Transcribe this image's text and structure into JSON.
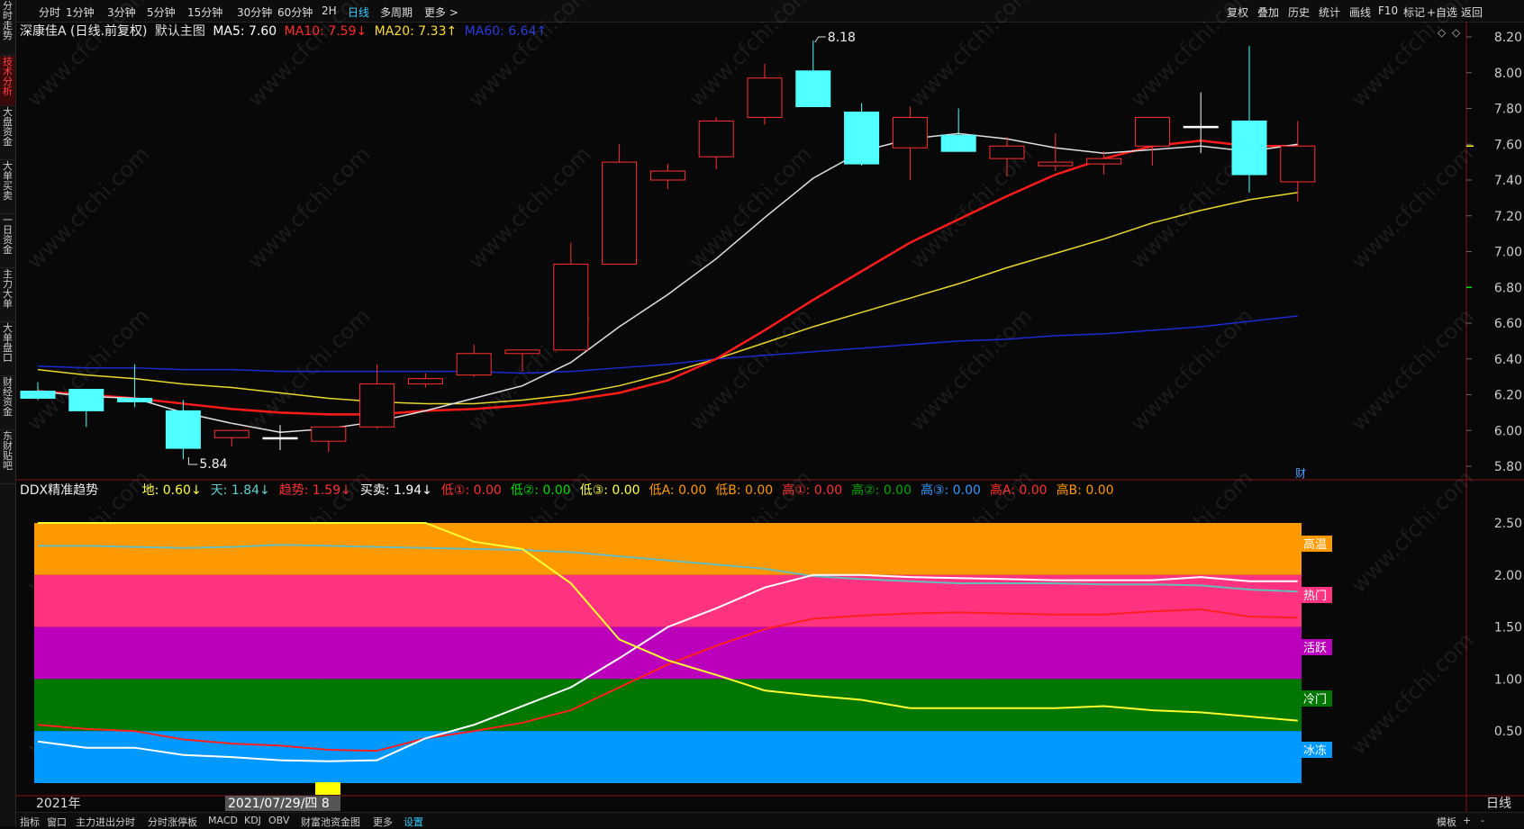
{
  "side_tabs": [
    "分时走势",
    "技术分析",
    "大盘资金",
    "大单买卖",
    "一日资金",
    "主力大单",
    "大单盘口",
    "财经资金",
    "东财贴吧"
  ],
  "side_active": 1,
  "top_menu": [
    "分时",
    "1分钟",
    "3分钟",
    "5分钟",
    "15分钟",
    "30分钟",
    "60分钟",
    "2H",
    "日线",
    "多周期",
    "更多 >"
  ],
  "top_active": 8,
  "top_right": [
    "复权",
    "叠加",
    "历史",
    "统计",
    "画线",
    "F10",
    "标记",
    "+自选",
    "返回"
  ],
  "chart1": {
    "name": "深康佳A (日线.前复权)",
    "main_label": "默认主图",
    "ma5": "MA5: 7.60",
    "ma10": "MA10: 7.59↓",
    "ma20": "MA20: 7.33↑",
    "ma60": "MA60: 6.64↑",
    "hi_label": "8.18",
    "lo_label": "5.84",
    "fin_tag": "财"
  },
  "chart2": {
    "name": "DDX精准趋势",
    "items": [
      {
        "t": "地: 0.60↓",
        "c": "#ffff40"
      },
      {
        "t": "天: 1.84↓",
        "c": "#66cccc"
      },
      {
        "t": "趋势: 1.59↓",
        "c": "#ff3030"
      },
      {
        "t": "买卖: 1.94↓",
        "c": "#ffffff"
      },
      {
        "t": "低①: 0.00",
        "c": "#ff3030"
      },
      {
        "t": "低②: 0.00",
        "c": "#00dd00"
      },
      {
        "t": "低③: 0.00",
        "c": "#ffff40"
      },
      {
        "t": "低A: 0.00",
        "c": "#ff9900"
      },
      {
        "t": "低B: 0.00",
        "c": "#ff9900"
      },
      {
        "t": "高①: 0.00",
        "c": "#ff3030"
      },
      {
        "t": "高②: 0.00",
        "c": "#00aa00"
      },
      {
        "t": "高③: 0.00",
        "c": "#3399ff"
      },
      {
        "t": "高A: 0.00",
        "c": "#ff3030"
      },
      {
        "t": "高B: 0.00",
        "c": "#ff9900"
      }
    ],
    "zones": [
      "高温",
      "热门",
      "活跃",
      "冷门",
      "冰冻"
    ]
  },
  "y_axis_top": [
    "8.20",
    "8.00",
    "7.80",
    "7.60",
    "7.40",
    "7.20",
    "7.00",
    "6.80",
    "6.60",
    "6.40",
    "6.20",
    "6.00",
    "5.80"
  ],
  "y_axis_bottom": [
    "2.50",
    "2.00",
    "1.50",
    "1.00",
    "0.50"
  ],
  "date_left": "2021年",
  "date_cursor": "2021/07/29/四 8",
  "bottom_tabs": [
    "指标",
    "窗口",
    "主力进出分时",
    "分时涨停板",
    "MACD",
    "KDJ",
    "OBV",
    "财富池资金图",
    "更多",
    "设置"
  ],
  "bottom_right": [
    "模板",
    "+",
    "-"
  ],
  "period_label": "日线",
  "watermark": "www.cfchi.com",
  "chart_data": {
    "type": "candlestick",
    "candles": [
      {
        "o": 6.22,
        "c": 6.18,
        "h": 6.27,
        "l": 6.17
      },
      {
        "o": 6.23,
        "c": 6.11,
        "h": 6.23,
        "l": 6.02
      },
      {
        "o": 6.18,
        "c": 6.16,
        "h": 6.37,
        "l": 6.13
      },
      {
        "o": 6.11,
        "c": 5.9,
        "h": 6.17,
        "l": 5.84
      },
      {
        "o": 5.96,
        "c": 6.0,
        "h": 6.0,
        "l": 5.91
      },
      {
        "o": 5.96,
        "c": 5.96,
        "h": 6.03,
        "l": 5.89
      },
      {
        "o": 5.94,
        "c": 6.02,
        "h": 6.02,
        "l": 5.88
      },
      {
        "o": 6.02,
        "c": 6.26,
        "h": 6.37,
        "l": 6.01
      },
      {
        "o": 6.26,
        "c": 6.29,
        "h": 6.32,
        "l": 6.24
      },
      {
        "o": 6.31,
        "c": 6.43,
        "h": 6.48,
        "l": 6.3
      },
      {
        "o": 6.43,
        "c": 6.45,
        "h": 6.45,
        "l": 6.33
      },
      {
        "o": 6.45,
        "c": 6.93,
        "h": 7.05,
        "l": 6.45
      },
      {
        "o": 6.93,
        "c": 7.5,
        "h": 7.6,
        "l": 6.93
      },
      {
        "o": 7.4,
        "c": 7.45,
        "h": 7.49,
        "l": 7.35
      },
      {
        "o": 7.53,
        "c": 7.73,
        "h": 7.75,
        "l": 7.46
      },
      {
        "o": 7.75,
        "c": 7.97,
        "h": 8.05,
        "l": 7.71
      },
      {
        "o": 8.01,
        "c": 7.81,
        "h": 8.18,
        "l": 7.81
      },
      {
        "o": 7.78,
        "c": 7.49,
        "h": 7.83,
        "l": 7.48
      },
      {
        "o": 7.58,
        "c": 7.75,
        "h": 7.81,
        "l": 7.4
      },
      {
        "o": 7.65,
        "c": 7.56,
        "h": 7.8,
        "l": 7.56
      },
      {
        "o": 7.52,
        "c": 7.59,
        "h": 7.64,
        "l": 7.42
      },
      {
        "o": 7.48,
        "c": 7.5,
        "h": 7.66,
        "l": 7.45
      },
      {
        "o": 7.49,
        "c": 7.52,
        "h": 7.56,
        "l": 7.43
      },
      {
        "o": 7.59,
        "c": 7.75,
        "h": 7.75,
        "l": 7.48
      },
      {
        "o": 7.7,
        "c": 7.7,
        "h": 7.89,
        "l": 7.55
      },
      {
        "o": 7.73,
        "c": 7.43,
        "h": 8.15,
        "l": 7.33
      },
      {
        "o": 7.39,
        "c": 7.59,
        "h": 7.73,
        "l": 7.28
      }
    ],
    "ma5": [
      6.22,
      6.19,
      6.18,
      6.1,
      6.04,
      5.99,
      6.01,
      6.05,
      6.11,
      6.18,
      6.25,
      6.38,
      6.58,
      6.76,
      6.96,
      7.19,
      7.41,
      7.56,
      7.63,
      7.66,
      7.63,
      7.58,
      7.55,
      7.57,
      7.59,
      7.56,
      7.6
    ],
    "ma10": [
      6.22,
      6.2,
      6.18,
      6.15,
      6.12,
      6.1,
      6.09,
      6.09,
      6.11,
      6.12,
      6.14,
      6.17,
      6.21,
      6.28,
      6.4,
      6.56,
      6.73,
      6.89,
      7.05,
      7.18,
      7.31,
      7.43,
      7.52,
      7.59,
      7.62,
      7.59,
      7.59
    ],
    "ma20": [
      6.34,
      6.31,
      6.29,
      6.26,
      6.24,
      6.21,
      6.18,
      6.16,
      6.15,
      6.15,
      6.17,
      6.2,
      6.25,
      6.32,
      6.4,
      6.49,
      6.58,
      6.66,
      6.74,
      6.82,
      6.91,
      6.99,
      7.07,
      7.16,
      7.23,
      7.29,
      7.33
    ],
    "ma60": [
      6.36,
      6.35,
      6.35,
      6.34,
      6.34,
      6.33,
      6.33,
      6.33,
      6.33,
      6.33,
      6.32,
      6.33,
      6.35,
      6.37,
      6.4,
      6.42,
      6.44,
      6.46,
      6.48,
      6.5,
      6.51,
      6.53,
      6.54,
      6.56,
      6.58,
      6.61,
      6.64
    ],
    "ddx_di": [
      2.5,
      2.5,
      2.5,
      2.5,
      2.5,
      2.5,
      2.5,
      2.5,
      2.5,
      2.32,
      2.25,
      1.92,
      1.38,
      1.18,
      1.04,
      0.89,
      0.84,
      0.8,
      0.72,
      0.72,
      0.72,
      0.72,
      0.74,
      0.7,
      0.68,
      0.64,
      0.6
    ],
    "ddx_tian": [
      2.28,
      2.28,
      2.27,
      2.26,
      2.27,
      2.29,
      2.28,
      2.27,
      2.26,
      2.25,
      2.24,
      2.22,
      2.18,
      2.14,
      2.1,
      2.06,
      1.99,
      1.96,
      1.94,
      1.92,
      1.92,
      1.92,
      1.91,
      1.91,
      1.9,
      1.86,
      1.84
    ],
    "ddx_trend": [
      0.56,
      0.52,
      0.5,
      0.42,
      0.38,
      0.36,
      0.32,
      0.31,
      0.43,
      0.5,
      0.58,
      0.7,
      0.92,
      1.14,
      1.32,
      1.48,
      1.58,
      1.61,
      1.63,
      1.64,
      1.63,
      1.62,
      1.62,
      1.65,
      1.67,
      1.6,
      1.59
    ],
    "ddx_bs": [
      0.4,
      0.34,
      0.34,
      0.27,
      0.25,
      0.22,
      0.21,
      0.22,
      0.43,
      0.56,
      0.74,
      0.92,
      1.2,
      1.5,
      1.68,
      1.88,
      2.0,
      2.0,
      1.98,
      1.97,
      1.96,
      1.95,
      1.95,
      1.95,
      1.98,
      1.94,
      1.94
    ],
    "zones_ranges": [
      [
        2.0,
        2.5
      ],
      [
        1.5,
        2.0
      ],
      [
        1.0,
        1.5
      ],
      [
        0.5,
        1.0
      ],
      [
        0.0,
        0.5
      ]
    ],
    "zone_colors": [
      "#ff9900",
      "#ff3380",
      "#bb00bb",
      "#007700",
      "#0099ff"
    ],
    "price_ylim": [
      5.75,
      8.27
    ],
    "ddx_ylim": [
      0.0,
      2.5
    ]
  }
}
